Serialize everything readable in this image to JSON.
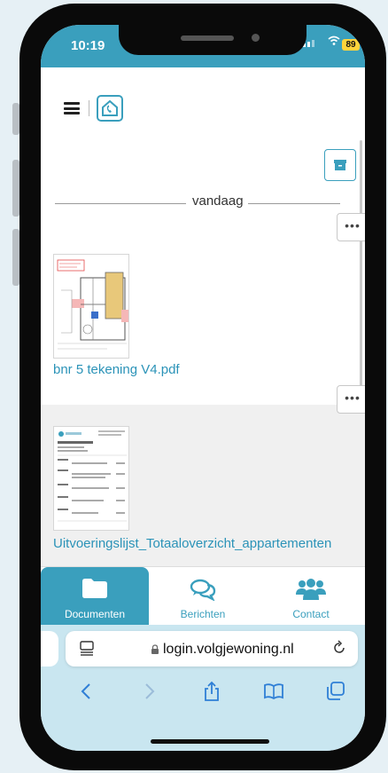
{
  "status_bar": {
    "time": "10:19",
    "battery": "89"
  },
  "header": {
    "logo_icon": "house-phone-logo-icon",
    "menu_icon": "hamburger-icon"
  },
  "toolbar": {
    "archive_icon": "archive-box-icon"
  },
  "feed": {
    "date_divider": "vandaag",
    "more_label": "•••",
    "documents": [
      {
        "name": "bnr 5 tekening V4.pdf",
        "thumb": "floor-plan-thumbnail"
      },
      {
        "name": "Uitvoeringslijst_Totaaloverzicht_appartementen",
        "thumb": "document-list-thumbnail"
      }
    ]
  },
  "bottom_nav": {
    "items": [
      {
        "label": "Documenten",
        "icon": "folder-icon",
        "active": true
      },
      {
        "label": "Berichten",
        "icon": "chat-bubbles-icon",
        "active": false
      },
      {
        "label": "Contact",
        "icon": "users-icon",
        "active": false
      }
    ]
  },
  "browser": {
    "url": "login.volgjewoning.nl",
    "toolbar_icons": [
      "back-icon",
      "forward-icon",
      "share-icon",
      "bookmarks-icon",
      "tabs-icon"
    ]
  },
  "colors": {
    "accent": "#3a9fbd",
    "link": "#2b93b8",
    "battery": "#ffd43b",
    "browser_bar": "#c9e6f0"
  }
}
